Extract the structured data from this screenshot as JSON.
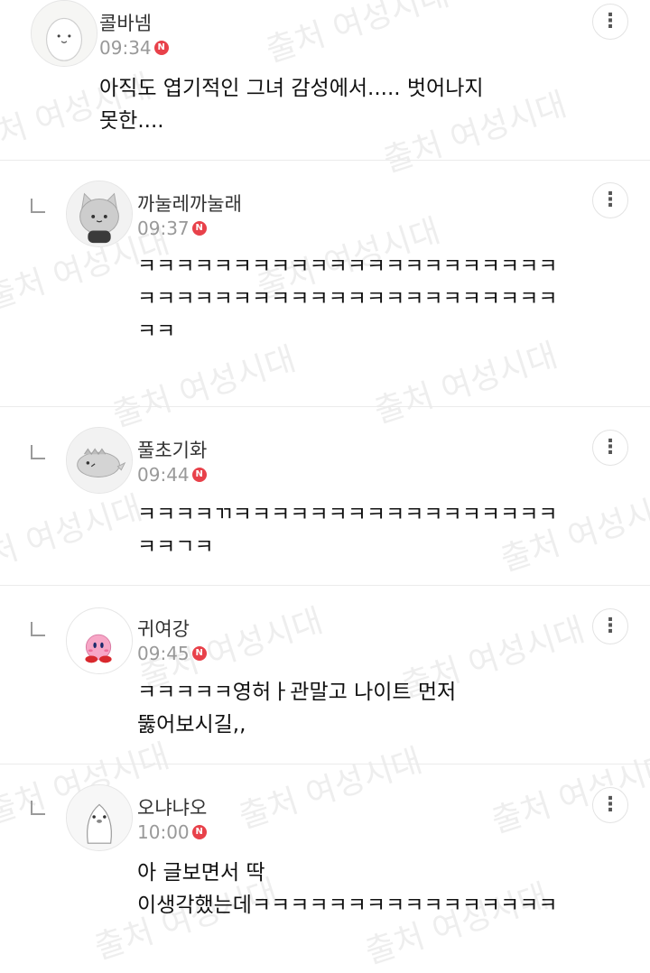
{
  "comments": [
    {
      "nickname": "콜바넴",
      "time": "09:34",
      "badge": "N",
      "text": "아직도 엽기적인 그녀 감성에서..... 벗어나지\n못한....",
      "is_reply": false,
      "avatar_icon": "white-ghost-character-icon"
    },
    {
      "nickname": "까눌레까눌래",
      "time": "09:37",
      "badge": "N",
      "text": "ㅋㅋㅋㅋㅋㅋㅋㅋㅋㅋㅋㅋㅋㅋㅋㅋㅋㅋㅋㅋㅋㅋㅋㅋㅋㅋㅋㅋㅋㅋㅋㅋㅋㅋㅋㅋㅋㅋㅋㅋㅋㅋㅋㅋㅋㅋ",
      "is_reply": true,
      "avatar_icon": "gray-cat-character-icon"
    },
    {
      "nickname": "풀초기화",
      "time": "09:44",
      "badge": "N",
      "text": "ㅋㅋㅋㅋㄲㅋㅋㅋㅋㅋㅋㅋㅋㅋㅋㅋㅋㅋㅋㅋㅋㅋㅋㅋㄱㅋ",
      "is_reply": true,
      "avatar_icon": "gray-dinosaur-character-icon"
    },
    {
      "nickname": "귀여강",
      "time": "09:45",
      "badge": "N",
      "text": "ㅋㅋㅋㅋㅋ영허ㅏ관말고 나이트 먼저\n뚫어보시길,,",
      "is_reply": true,
      "avatar_icon": "pink-kirby-character-icon"
    },
    {
      "nickname": "오냐냐오",
      "time": "10:00",
      "badge": "N",
      "text": "아 글보면서 딱\n이생각했는데ㅋㅋㅋㅋㅋㅋㅋㅋㅋㅋㅋㅋㅋㅋㅋㅋ",
      "is_reply": true,
      "avatar_icon": "white-penguin-character-icon"
    }
  ],
  "more_icon": "⋮",
  "watermark_text": "출처 여성시대",
  "colors": {
    "badge": "#e8414a",
    "text": "#111111",
    "meta": "#999999",
    "divider": "#ebebeb"
  }
}
